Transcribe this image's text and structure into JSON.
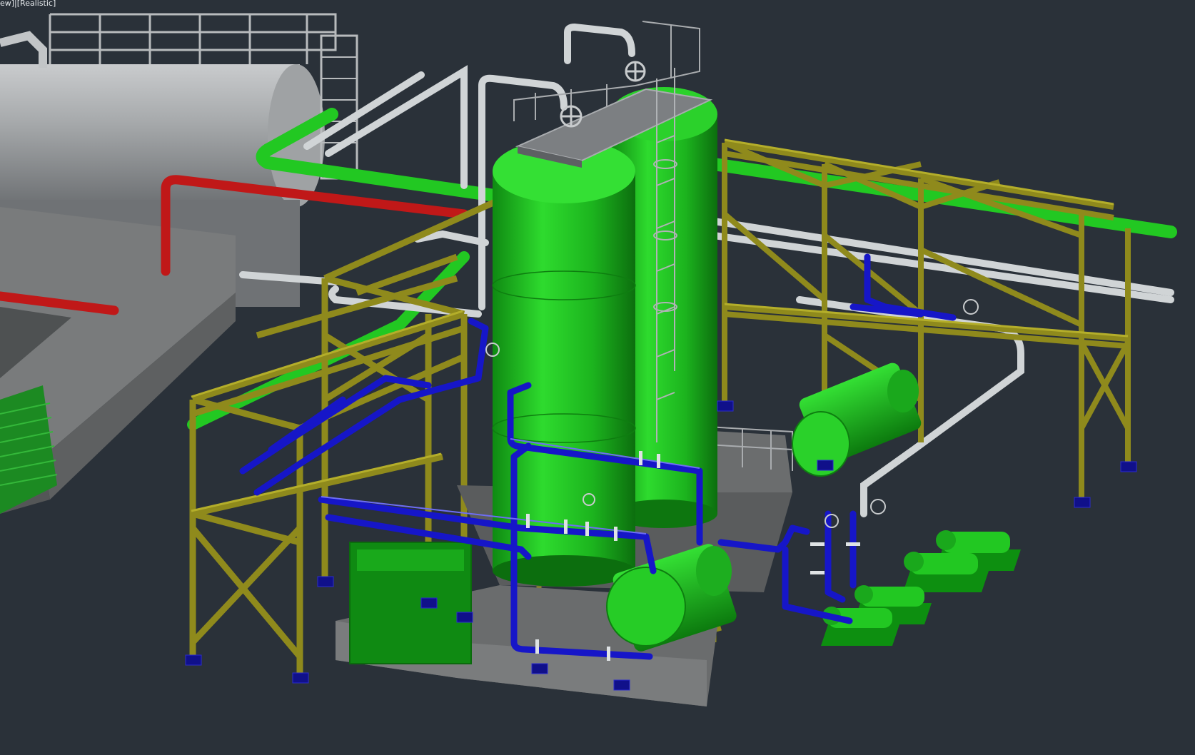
{
  "viewport": {
    "label": "ew]|[Realistic]"
  },
  "scene": {
    "background": "#2a3139",
    "colors": {
      "structure_yellow": "#8f8a1c",
      "structure_yellow_light": "#b4ae2a",
      "vessel_green": "#1fc21f",
      "vessel_green_dark": "#0e7e10",
      "pipe_blue": "#1616c8",
      "pipe_red": "#c01818",
      "pipe_white": "#d2d6d8",
      "equipment_grey": "#8c8f92",
      "concrete_grey": "#6d6f70",
      "base_plate_blue": "#10108a"
    }
  }
}
